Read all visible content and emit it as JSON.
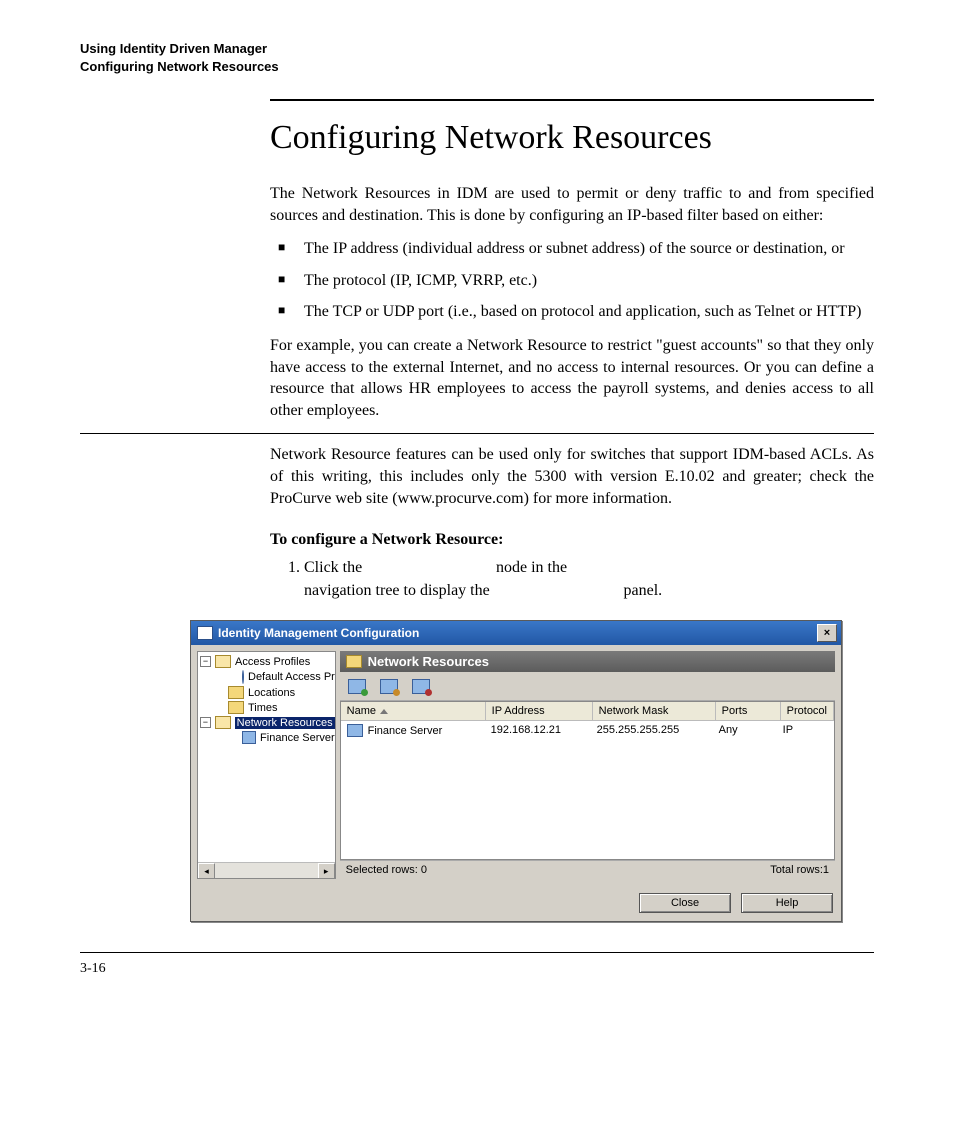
{
  "running_head": {
    "line1": "Using Identity Driven Manager",
    "line2": "Configuring Network Resources"
  },
  "heading": "Configuring Network Resources",
  "intro": "The Network Resources in IDM are used to permit or deny traffic to and from specified sources and destination. This is done by configuring an IP-based filter based on either:",
  "bullets": [
    "The IP address (individual address or subnet address) of the source or destination, or",
    "The protocol (IP, ICMP, VRRP, etc.)",
    "The TCP or UDP port (i.e., based on protocol and application, such as Telnet or HTTP)"
  ],
  "para2": "For example, you can create a Network Resource to restrict \"guest accounts\" so that they only have access to the external Internet, and no access to internal resources. Or you can define a resource that allows HR employees to access the payroll systems, and denies access to all other employees.",
  "para3": "Network Resource features can be used only for switches that support IDM-based ACLs.  As of this writing, this includes only the 5300 with version E.10.02 and greater; check the ProCurve web site (www.procurve.com) for more information.",
  "subhead": "To configure a Network Resource:",
  "step1_a": "Click the ",
  "step1_b": " node in the ",
  "step1_c": "navigation tree to display the ",
  "step1_d": " panel.",
  "window": {
    "title": "Identity Management Configuration",
    "close": "×",
    "tree": {
      "access_profiles": "Access Profiles",
      "default_access": "Default Access Pr",
      "locations": "Locations",
      "times": "Times",
      "network_resources": "Network Resources",
      "finance_server": "Finance Server",
      "scroll_left": "◂",
      "scroll_right": "▸"
    },
    "panel_title": "Network Resources",
    "columns": {
      "name": "Name",
      "ip": "IP Address",
      "mask": "Network Mask",
      "ports": "Ports",
      "protocol": "Protocol"
    },
    "row": {
      "name": "Finance Server",
      "ip": "192.168.12.21",
      "mask": "255.255.255.255",
      "ports": "Any",
      "protocol": "IP"
    },
    "status_left": "Selected rows: 0",
    "status_right": "Total rows:1",
    "btn_close": "Close",
    "btn_help": "Help"
  },
  "page_number": "3-16"
}
